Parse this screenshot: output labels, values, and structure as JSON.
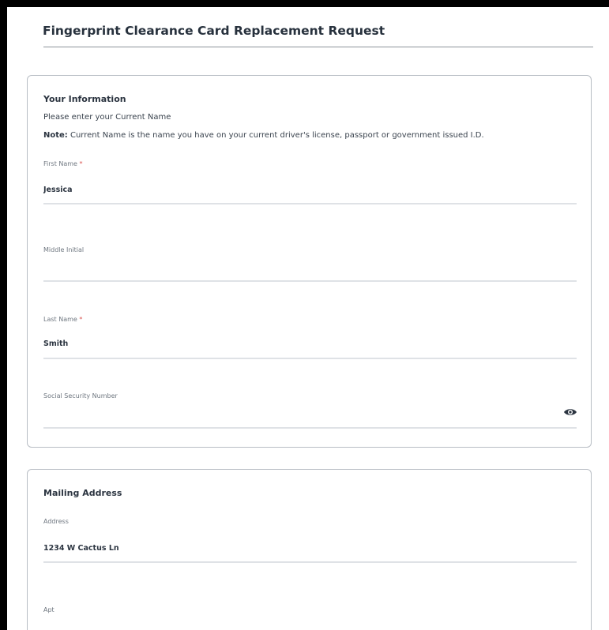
{
  "page": {
    "title": "Fingerprint Clearance Card Replacement Request"
  },
  "your_information": {
    "heading": "Your Information",
    "instruction": "Please enter your Current Name",
    "note_label": "Note:",
    "note_text": " Current Name is the name you have on your current driver's license, passport or government issued I.D.",
    "fields": {
      "first_name": {
        "label": "First Name",
        "required_mark": "*",
        "value": "Jessica"
      },
      "middle_initial": {
        "label": "Middle Initial",
        "value": ""
      },
      "last_name": {
        "label": "Last Name",
        "required_mark": "*",
        "value": "Smith"
      },
      "ssn": {
        "label": "Social Security Number",
        "value": "",
        "toggle_icon": "eye-icon"
      }
    }
  },
  "mailing_address": {
    "heading": "Mailing Address",
    "fields": {
      "address": {
        "label": "Address",
        "value": "1234 W Cactus Ln"
      },
      "apt": {
        "label": "Apt",
        "value": ""
      }
    }
  },
  "colors": {
    "required_asterisk": "#d9534f",
    "text": "#2b3440",
    "border": "#b8bdc4",
    "frame": "#000000"
  }
}
